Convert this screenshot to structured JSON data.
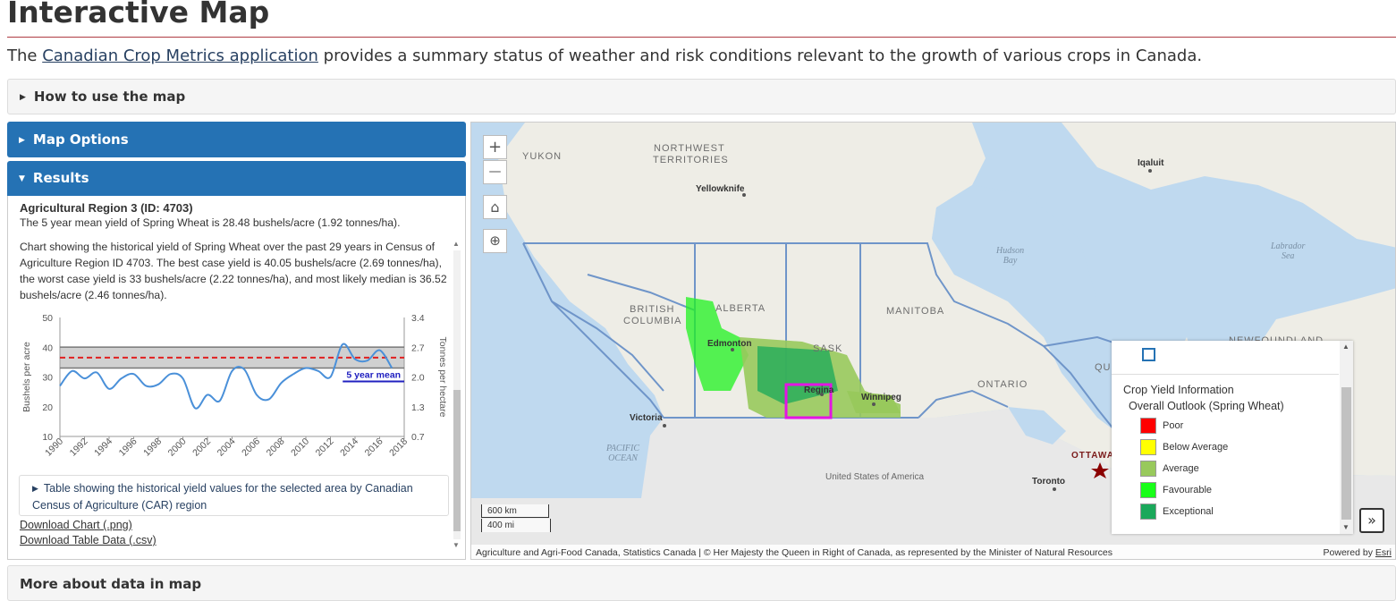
{
  "page": {
    "title": "Interactive Map",
    "intro_prefix": "The ",
    "intro_link": "Canadian Crop Metrics application",
    "intro_suffix": " provides a summary status of weather and risk conditions relevant to the growth of various crops in Canada."
  },
  "accordions": {
    "how_to": "How to use the map",
    "map_options": "Map Options",
    "results": "Results",
    "more_about": "More about data in map"
  },
  "results": {
    "heading": "Agricultural Region 3 (ID: 4703)",
    "mean_text": "The 5 year mean yield of Spring Wheat is 28.48 bushels/acre (1.92 tonnes/ha).",
    "chart_desc": "Chart showing the historical yield of Spring Wheat over the past 29 years in Census of Agriculture Region ID 4703. The best case yield is 40.05 bushels/acre (2.69 tonnes/ha), the worst case yield is 33 bushels/acre (2.22 tonnes/ha), and most likely median is 36.52 bushels/acre (2.46 tonnes/ha).",
    "table_toggle": "Table showing the historical yield values for the selected area by Canadian Census of Agriculture (CAR) region",
    "download_chart": "Download Chart (.png)",
    "download_table": "Download Table Data (.csv)"
  },
  "chart_data": {
    "type": "line",
    "xlabel": "",
    "ylabel": "Bushels per acre",
    "y2label": "Tonnes per hectare",
    "x_ticks": [
      "1990",
      "1992",
      "1994",
      "1996",
      "1998",
      "2000",
      "2002",
      "2004",
      "2006",
      "2008",
      "2010",
      "2012",
      "2014",
      "2016",
      "2018"
    ],
    "y_ticks": [
      "10",
      "20",
      "30",
      "40",
      "50"
    ],
    "y2_ticks": [
      "0.7",
      "1.3",
      "2.0",
      "2.7",
      "3.4"
    ],
    "ylim": [
      10,
      50
    ],
    "xlim": [
      1990,
      2018
    ],
    "series": [
      {
        "name": "",
        "x": [
          1990,
          1991,
          1992,
          1993,
          1994,
          1995,
          1996,
          1997,
          1998,
          1999,
          2000,
          2001,
          2002,
          2003,
          2004,
          2005,
          2006,
          2007,
          2008,
          2009,
          2010,
          2011,
          2012,
          2013,
          2014,
          2015,
          2016,
          2017
        ],
        "values": [
          27,
          32,
          29.5,
          31.5,
          26,
          29.5,
          31,
          27,
          27.5,
          31,
          29.5,
          19.5,
          24,
          22,
          32,
          32.5,
          24,
          22.5,
          28,
          31,
          33,
          32,
          30,
          41,
          36,
          35.5,
          39,
          33
        ],
        "color": "#4a90d9"
      }
    ],
    "reference_lines": [
      {
        "label": "best case",
        "value": 40.05,
        "color": "#777777"
      },
      {
        "label": "worst case",
        "value": 33,
        "color": "#777777"
      },
      {
        "label": "median",
        "value": 36.52,
        "color": "#e02020"
      },
      {
        "label": "5 year mean",
        "value": 28.48,
        "color": "#2020c0"
      }
    ],
    "band": {
      "from": 33,
      "to": 40.05,
      "color": "#d0d0d0"
    },
    "annotation": "5 year mean",
    "grid": false
  },
  "map": {
    "labels": {
      "yukon": "YUKON",
      "nwt_1": "NORTHWEST",
      "nwt_2": "TERRITORIES",
      "bc_1": "BRITISH",
      "bc_2": "COLUMBIA",
      "alberta": "ALBERTA",
      "sask": "SASK",
      "manitoba": "MANITOBA",
      "ontario": "ONTARIO",
      "quebec": "QU",
      "newfoundland": "NEWFOUNDLAND",
      "us": "United States of America",
      "hudson_1": "Hudson",
      "hudson_2": "Bay",
      "labrador_1": "Labrador",
      "labrador_2": "Sea",
      "pacific_1": "PACIFIC",
      "pacific_2": "OCEAN"
    },
    "cities": {
      "yellowknife": "Yellowknife",
      "iqaluit": "Iqaluit",
      "edmonton": "Edmonton",
      "regina": "Regina",
      "winnipeg": "Winnipeg",
      "victoria": "Victoria",
      "toronto": "Toronto",
      "ottawa": "OTTAWA"
    },
    "controls": {
      "zoom_in": "+",
      "zoom_out": "—",
      "home": "⌂",
      "zoom_extent": "⊕",
      "expand": "»"
    },
    "scale": {
      "km": "600 km",
      "mi": "400 mi"
    },
    "attribution": "Agriculture and Agri-Food Canada, Statistics Canada | © Her Majesty the Queen in Right of Canada, as represented by the Minister of Natural Resources",
    "powered_by": "Powered by ",
    "esri": "Esri"
  },
  "legend": {
    "title": "Crop Yield Information",
    "subtitle": "Overall Outlook (Spring Wheat)",
    "items": [
      {
        "label": "Poor",
        "color": "#ff0000"
      },
      {
        "label": "Below Average",
        "color": "#ffff00"
      },
      {
        "label": "Average",
        "color": "#98c95c"
      },
      {
        "label": "Favourable",
        "color": "#19ff19"
      },
      {
        "label": "Exceptional",
        "color": "#1aa85a"
      }
    ]
  }
}
